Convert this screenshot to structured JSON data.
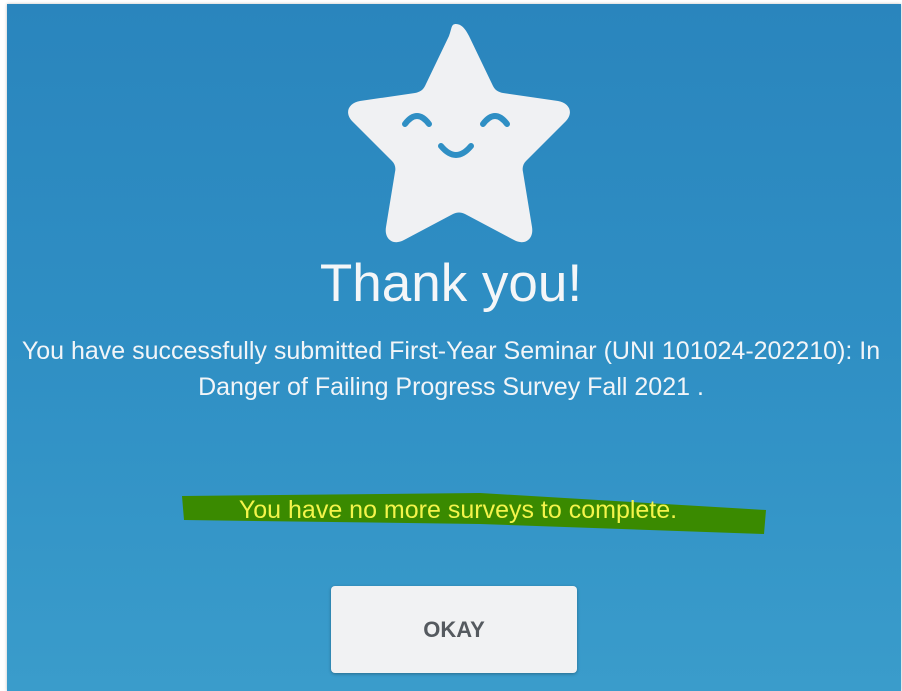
{
  "dialog": {
    "title": "Thank you!",
    "message": "You have successfully submitted First-Year Seminar (UNI 101024-202210): In Danger of Failing Progress Survey Fall 2021 .",
    "status": "You have no more surveys to complete.",
    "okay_label": "OKAY",
    "icon": "smiling-star-icon"
  },
  "colors": {
    "background": "#2f8fc4",
    "star": "#f0f1f3",
    "face": "#2f8fc4",
    "text": "#f2f5f8",
    "highlight_text": "#f4f44a",
    "highlight_mark": "#3a8a00",
    "button_bg": "#f1f2f3",
    "button_text": "#555a5f"
  }
}
